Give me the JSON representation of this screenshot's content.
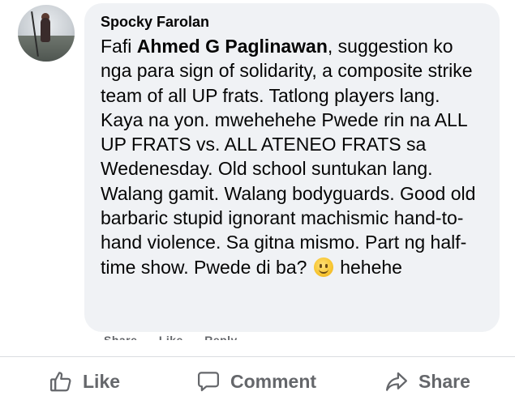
{
  "comment": {
    "author": "Spocky Farolan",
    "text_before_mention": "Fafi ",
    "mention": "Ahmed G Paglinawan",
    "text_after_mention": ", suggestion ko nga para sign of solidarity, a composite strike team of all UP frats. Tatlong players lang. Kaya na yon. mwehehehe Pwede rin na ALL UP FRATS vs. ALL ATENEO FRATS sa Wedenesday. Old school suntukan lang. Walang gamit. Walang bodyguards. Good old barbaric stupid ignorant machismic hand-to-hand violence. Sa gitna mismo. Part ng half-time show. Pwede di ba? ",
    "emoji": "slightly-smiling-face-icon",
    "text_after_emoji": " hehehe"
  },
  "comment_actions": {
    "share_label": "Share",
    "like_label": "Like",
    "reply_label": "Reply"
  },
  "post_actions": {
    "like_label": "Like",
    "comment_label": "Comment",
    "share_label": "Share"
  },
  "colors": {
    "bubble_bg": "#f0f2f5",
    "action_text": "#65676b",
    "text": "#050505"
  }
}
